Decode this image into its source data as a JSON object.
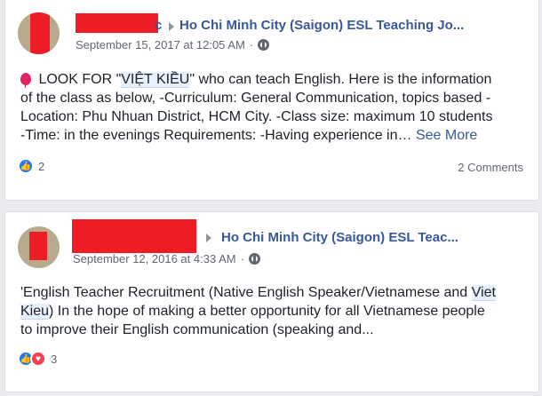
{
  "posts": [
    {
      "author_suffix": "c",
      "group_name": "Ho Chi Minh City (Saigon) ESL Teaching Jo...",
      "timestamp": "September 15, 2017 at 12:05 AM",
      "separator": "·",
      "privacy_icon": "friends-icon",
      "body": {
        "emoji": "balloon-icon",
        "line1_pre": " LOOK FOR \"",
        "line1_hl": "VIỆT KIỀU",
        "line1_post": "\" who can teach English. Here is the information",
        "line2": "of the class as below, -Curriculum: General Communication, topics based -",
        "line3": "Location: Phu Nhuan District, HCM City. -Class size: maximum 10 students",
        "line4": "-Time: in the evenings Requirements: -Having experience in…",
        "see_more": "See More"
      },
      "reaction_count": "2",
      "reaction_icons": [
        "like-icon"
      ],
      "comments": "2 Comments"
    },
    {
      "group_name": "Ho Chi Minh City (Saigon) ESL Teac...",
      "timestamp": "September 12, 2016 at 4:33 AM",
      "separator": "·",
      "privacy_icon": "friends-icon",
      "body": {
        "line1_pre": "'English Teacher Recruitment (Native English Speaker/Vietnamese and ",
        "line1_hl": "Viet",
        "line2_hl": "Kieu",
        "line2_post": ") In the hope of making a better opportunity for all Vietnamese people",
        "line3": "to improve their English communication (speaking and..."
      },
      "reaction_count": "3",
      "reaction_icons": [
        "like-icon",
        "love-icon"
      ]
    }
  ]
}
